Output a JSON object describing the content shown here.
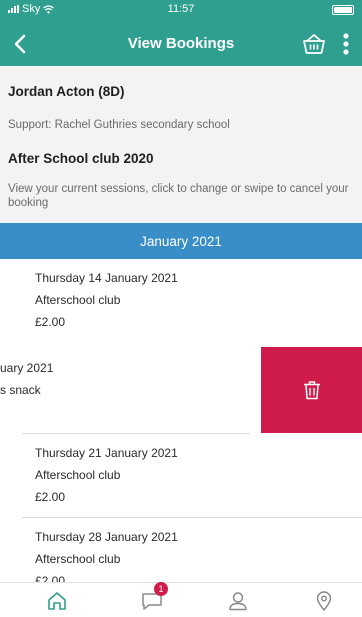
{
  "status_bar": {
    "carrier": "Sky",
    "time": "11:57"
  },
  "navbar": {
    "title": "View Bookings"
  },
  "info": {
    "student": "Jordan Acton (8D)",
    "support": "Support: Rachel Guthries secondary school",
    "club": "After School club 2020",
    "instructions": "View your current sessions, click to change or swipe to cancel your booking"
  },
  "month": "January 2021",
  "bookings": [
    {
      "date": "Thursday 14 January 2021",
      "session": "Afterschool club",
      "price": "£2.00"
    },
    {
      "date": "uary 2021",
      "session": "s snack"
    },
    {
      "date": "Thursday 21 January 2021",
      "session": "Afterschool club",
      "price": "£2.00"
    },
    {
      "date": "Thursday 28 January 2021",
      "session": "Afterschool club",
      "price": "£2.00"
    }
  ],
  "tabs": {
    "messages_badge": "1"
  },
  "colors": {
    "header": "#2f9f8f",
    "month_bar": "#3a8ec8",
    "delete": "#d01c4a",
    "tab_active": "#2f9f8f",
    "tab_inactive": "#8a8a8a"
  }
}
